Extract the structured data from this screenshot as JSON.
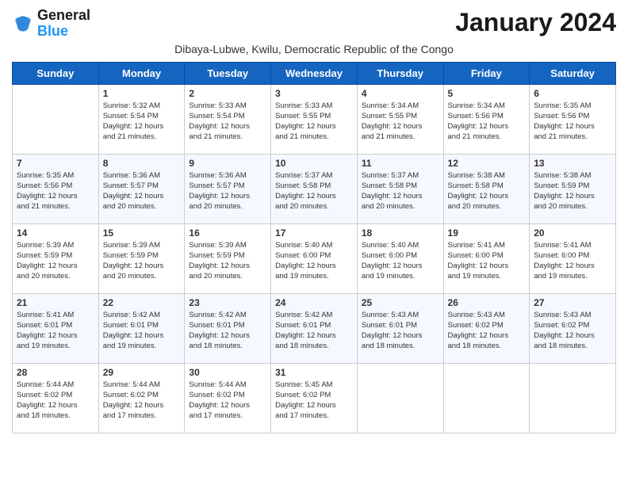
{
  "logo": {
    "text_general": "General",
    "text_blue": "Blue"
  },
  "title": "January 2024",
  "location": "Dibaya-Lubwe, Kwilu, Democratic Republic of the Congo",
  "days_of_week": [
    "Sunday",
    "Monday",
    "Tuesday",
    "Wednesday",
    "Thursday",
    "Friday",
    "Saturday"
  ],
  "weeks": [
    [
      {
        "day": "",
        "info": ""
      },
      {
        "day": "1",
        "info": "Sunrise: 5:32 AM\nSunset: 5:54 PM\nDaylight: 12 hours\nand 21 minutes."
      },
      {
        "day": "2",
        "info": "Sunrise: 5:33 AM\nSunset: 5:54 PM\nDaylight: 12 hours\nand 21 minutes."
      },
      {
        "day": "3",
        "info": "Sunrise: 5:33 AM\nSunset: 5:55 PM\nDaylight: 12 hours\nand 21 minutes."
      },
      {
        "day": "4",
        "info": "Sunrise: 5:34 AM\nSunset: 5:55 PM\nDaylight: 12 hours\nand 21 minutes."
      },
      {
        "day": "5",
        "info": "Sunrise: 5:34 AM\nSunset: 5:56 PM\nDaylight: 12 hours\nand 21 minutes."
      },
      {
        "day": "6",
        "info": "Sunrise: 5:35 AM\nSunset: 5:56 PM\nDaylight: 12 hours\nand 21 minutes."
      }
    ],
    [
      {
        "day": "7",
        "info": "Sunrise: 5:35 AM\nSunset: 5:56 PM\nDaylight: 12 hours\nand 21 minutes."
      },
      {
        "day": "8",
        "info": "Sunrise: 5:36 AM\nSunset: 5:57 PM\nDaylight: 12 hours\nand 20 minutes."
      },
      {
        "day": "9",
        "info": "Sunrise: 5:36 AM\nSunset: 5:57 PM\nDaylight: 12 hours\nand 20 minutes."
      },
      {
        "day": "10",
        "info": "Sunrise: 5:37 AM\nSunset: 5:58 PM\nDaylight: 12 hours\nand 20 minutes."
      },
      {
        "day": "11",
        "info": "Sunrise: 5:37 AM\nSunset: 5:58 PM\nDaylight: 12 hours\nand 20 minutes."
      },
      {
        "day": "12",
        "info": "Sunrise: 5:38 AM\nSunset: 5:58 PM\nDaylight: 12 hours\nand 20 minutes."
      },
      {
        "day": "13",
        "info": "Sunrise: 5:38 AM\nSunset: 5:59 PM\nDaylight: 12 hours\nand 20 minutes."
      }
    ],
    [
      {
        "day": "14",
        "info": "Sunrise: 5:39 AM\nSunset: 5:59 PM\nDaylight: 12 hours\nand 20 minutes."
      },
      {
        "day": "15",
        "info": "Sunrise: 5:39 AM\nSunset: 5:59 PM\nDaylight: 12 hours\nand 20 minutes."
      },
      {
        "day": "16",
        "info": "Sunrise: 5:39 AM\nSunset: 5:59 PM\nDaylight: 12 hours\nand 20 minutes."
      },
      {
        "day": "17",
        "info": "Sunrise: 5:40 AM\nSunset: 6:00 PM\nDaylight: 12 hours\nand 19 minutes."
      },
      {
        "day": "18",
        "info": "Sunrise: 5:40 AM\nSunset: 6:00 PM\nDaylight: 12 hours\nand 19 minutes."
      },
      {
        "day": "19",
        "info": "Sunrise: 5:41 AM\nSunset: 6:00 PM\nDaylight: 12 hours\nand 19 minutes."
      },
      {
        "day": "20",
        "info": "Sunrise: 5:41 AM\nSunset: 6:00 PM\nDaylight: 12 hours\nand 19 minutes."
      }
    ],
    [
      {
        "day": "21",
        "info": "Sunrise: 5:41 AM\nSunset: 6:01 PM\nDaylight: 12 hours\nand 19 minutes."
      },
      {
        "day": "22",
        "info": "Sunrise: 5:42 AM\nSunset: 6:01 PM\nDaylight: 12 hours\nand 19 minutes."
      },
      {
        "day": "23",
        "info": "Sunrise: 5:42 AM\nSunset: 6:01 PM\nDaylight: 12 hours\nand 18 minutes."
      },
      {
        "day": "24",
        "info": "Sunrise: 5:42 AM\nSunset: 6:01 PM\nDaylight: 12 hours\nand 18 minutes."
      },
      {
        "day": "25",
        "info": "Sunrise: 5:43 AM\nSunset: 6:01 PM\nDaylight: 12 hours\nand 18 minutes."
      },
      {
        "day": "26",
        "info": "Sunrise: 5:43 AM\nSunset: 6:02 PM\nDaylight: 12 hours\nand 18 minutes."
      },
      {
        "day": "27",
        "info": "Sunrise: 5:43 AM\nSunset: 6:02 PM\nDaylight: 12 hours\nand 18 minutes."
      }
    ],
    [
      {
        "day": "28",
        "info": "Sunrise: 5:44 AM\nSunset: 6:02 PM\nDaylight: 12 hours\nand 18 minutes."
      },
      {
        "day": "29",
        "info": "Sunrise: 5:44 AM\nSunset: 6:02 PM\nDaylight: 12 hours\nand 17 minutes."
      },
      {
        "day": "30",
        "info": "Sunrise: 5:44 AM\nSunset: 6:02 PM\nDaylight: 12 hours\nand 17 minutes."
      },
      {
        "day": "31",
        "info": "Sunrise: 5:45 AM\nSunset: 6:02 PM\nDaylight: 12 hours\nand 17 minutes."
      },
      {
        "day": "",
        "info": ""
      },
      {
        "day": "",
        "info": ""
      },
      {
        "day": "",
        "info": ""
      }
    ]
  ]
}
